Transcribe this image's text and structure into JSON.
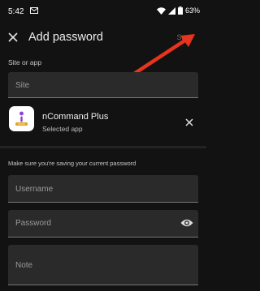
{
  "status_bar": {
    "time": "5:42",
    "battery": "63%",
    "icons": [
      "mail-icon",
      "wifi-icon",
      "signal-icon",
      "battery-icon"
    ]
  },
  "app_bar": {
    "title": "Add password",
    "save_label": "Save",
    "close_icon": "close-icon"
  },
  "site": {
    "section_label": "Site or app",
    "placeholder": "Site"
  },
  "selected_app": {
    "name": "nCommand Plus",
    "subtitle": "Selected app",
    "remove_icon": "close-icon"
  },
  "credentials": {
    "hint": "Make sure you're saving your current password",
    "username_placeholder": "Username",
    "password_placeholder": "Password",
    "note_placeholder": "Note",
    "show_password_icon": "eye-icon"
  },
  "colors": {
    "background": "#121212",
    "field": "#2a2a2a",
    "annotation_arrow": "#e8341c"
  }
}
